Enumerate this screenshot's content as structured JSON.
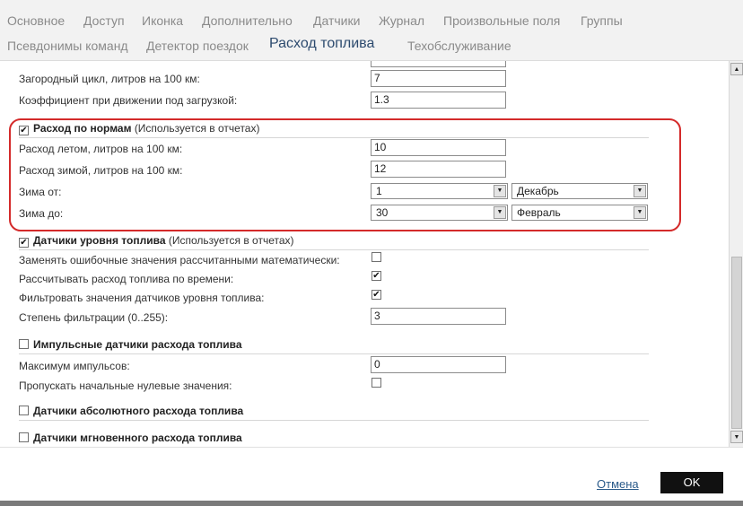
{
  "tabs": {
    "row1": [
      "Основное",
      "Доступ",
      "Иконка",
      "Дополнительно",
      "Датчики",
      "Журнал",
      "Произвольные поля",
      "Группы"
    ],
    "row2": [
      "Псевдонимы команд",
      "Детектор поездок",
      "Расход топлива",
      "Техобслуживание"
    ],
    "active": "Расход топлива"
  },
  "consumption": {
    "suburban_label": "Загородный цикл, литров на 100 км:",
    "suburban_value": "7",
    "load_coef_label": "Коэффициент при движении под загрузкой:",
    "load_coef_value": "1.3"
  },
  "norms": {
    "title": "Расход по нормам",
    "hint": "(Используется в отчетах)",
    "checked": true,
    "summer_label": "Расход летом, литров на 100 км:",
    "summer_value": "10",
    "winter_label": "Расход зимой, литров на 100 км:",
    "winter_value": "12",
    "winter_from_label": "Зима от:",
    "winter_from_day": "1",
    "winter_from_month": "Декабрь",
    "winter_to_label": "Зима до:",
    "winter_to_day": "30",
    "winter_to_month": "Февраль"
  },
  "level_sensors": {
    "title": "Датчики уровня топлива",
    "hint": "(Используется в отчетах)",
    "checked": true,
    "replace_label": "Заменять ошибочные значения рассчитанными математически:",
    "replace_checked": false,
    "by_time_label": "Рассчитывать расход топлива по времени:",
    "by_time_checked": true,
    "filter_label": "Фильтровать значения датчиков уровня топлива:",
    "filter_checked": true,
    "degree_label": "Степень фильтрации (0..255):",
    "degree_value": "3"
  },
  "impulse": {
    "title": "Импульсные датчики расхода топлива",
    "checked": false,
    "max_label": "Максимум импульсов:",
    "max_value": "0",
    "skip_zero_label": "Пропускать начальные нулевые значения:",
    "skip_zero_checked": false
  },
  "absolute": {
    "title": "Датчики абсолютного расхода топлива",
    "checked": false
  },
  "instant": {
    "title": "Датчики мгновенного расхода топлива",
    "checked": false
  },
  "footer": {
    "cancel": "Отмена",
    "ok": "OK"
  },
  "colors": {
    "highlight": "#d42a2a",
    "active_tab": "#2c4a6e",
    "ok_button": "#111111"
  }
}
